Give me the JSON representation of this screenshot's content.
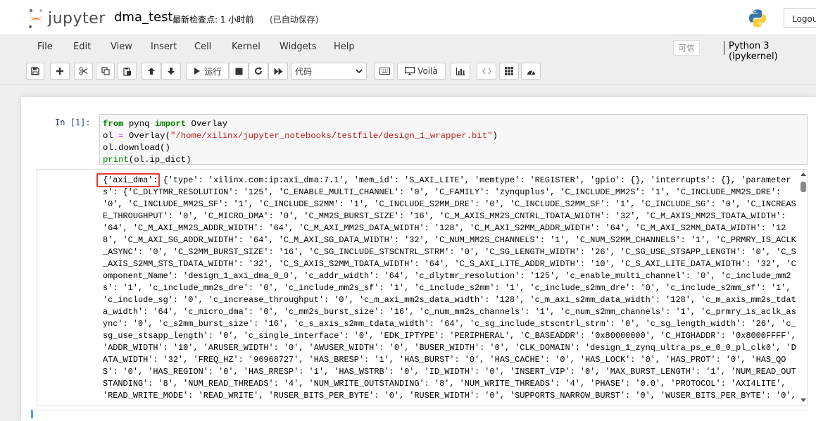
{
  "header": {
    "logo_text": "jupyter",
    "notebook_name": "dma_test",
    "checkpoint": "最新检查点: 1 小时前",
    "autosave": "(已自动保存)",
    "logout_label": "Logout"
  },
  "menubar": {
    "items": [
      "File",
      "Edit",
      "View",
      "Insert",
      "Cell",
      "Kernel",
      "Widgets",
      "Help"
    ],
    "trusted_label": "可信",
    "kernel_name": "Python 3 (ipykernel)"
  },
  "toolbar": {
    "save_icon": "save-icon",
    "add_icon": "plus-icon",
    "cut_icon": "scissors-icon",
    "copy_icon": "copy-icon",
    "paste_icon": "paste-icon",
    "move_up_icon": "arrow-up-icon",
    "move_down_icon": "arrow-down-icon",
    "run_label": "运行",
    "cell_type_selected": "代码",
    "voila_label": "Voilà"
  },
  "cell": {
    "prompt": "In  [1]:",
    "code": {
      "line1_kw1": "from",
      "line1_mod": " pynq ",
      "line1_kw2": "import",
      "line1_name": " Overlay",
      "line2_var": "ol ",
      "line2_eq": "=",
      "line2_call": " Overlay(",
      "line2_str": "\"/home/xilinx/jupyter_notebooks/testfile/design_1_wrapper.bit\"",
      "line2_close": ")",
      "line3": "ol.download()",
      "line4_fn": "print",
      "line4_rest": "(ol.ip_dict)"
    },
    "output_lines": [
      "{'axi_dma': {'type': 'xilinx.com:ip:axi_dma:7.1', 'mem_id': 'S_AXI_LITE', 'memtype': 'REGISTER', 'gpio': {}, 'interrupts': {}, 'parameter",
      "s': {'C_DLYTMR_RESOLUTION': '125', 'C_ENABLE_MULTI_CHANNEL': '0', 'C_FAMILY': 'zynquplus', 'C_INCLUDE_MM2S': '1', 'C_INCLUDE_MM2S_DRE':",
      "'0', 'C_INCLUDE_MM2S_SF': '1', 'C_INCLUDE_S2MM': '1', 'C_INCLUDE_S2MM_DRE': '0', 'C_INCLUDE_S2MM_SF': '1', 'C_INCLUDE_SG': '0', 'C_INCREAS",
      "E_THROUGHPUT': '0', 'C_MICRO_DMA': '0', 'C_MM2S_BURST_SIZE': '16', 'C_M_AXIS_MM2S_CNTRL_TDATA_WIDTH': '32', 'C_M_AXIS_MM2S_TDATA_WIDTH':",
      "'64', 'C_M_AXI_MM2S_ADDR_WIDTH': '64', 'C_M_AXI_MM2S_DATA_WIDTH': '128', 'C_M_AXI_S2MM_ADDR_WIDTH': '64', 'C_M_AXI_S2MM_DATA_WIDTH': '12",
      "8', 'C_M_AXI_SG_ADDR_WIDTH': '64', 'C_M_AXI_SG_DATA_WIDTH': '32', 'C_NUM_MM2S_CHANNELS': '1', 'C_NUM_S2MM_CHANNELS': '1', 'C_PRMRY_IS_ACLK",
      "_ASYNC': '0', 'C_S2MM_BURST_SIZE': '16', 'C_SG_INCLUDE_STSCNTRL_STRM': '0', 'C_SG_LENGTH_WIDTH': '26', 'C_SG_USE_STSAPP_LENGTH': '0', 'C_S",
      "_AXIS_S2MM_STS_TDATA_WIDTH': '32', 'C_S_AXIS_S2MM_TDATA_WIDTH': '64', 'C_S_AXI_LITE_ADDR_WIDTH': '10', 'C_S_AXI_LITE_DATA_WIDTH': '32', 'C",
      "omponent_Name': 'design_1_axi_dma_0_0', 'c_addr_width': '64', 'c_dlytmr_resolution': '125', 'c_enable_multi_channel': '0', 'c_include_mm2",
      "s': '1', 'c_include_mm2s_dre': '0', 'c_include_mm2s_sf': '1', 'c_include_s2mm': '1', 'c_include_s2mm_dre': '0', 'c_include_s2mm_sf': '1',",
      "'c_include_sg': '0', 'c_increase_throughput': '0', 'c_m_axi_mm2s_data_width': '128', 'c_m_axi_s2mm_data_width': '128', 'c_m_axis_mm2s_tdat",
      "a_width': '64', 'c_micro_dma': '0', 'c_mm2s_burst_size': '16', 'c_num_mm2s_channels': '1', 'c_num_s2mm_channels': '1', 'c_prmry_is_aclk_as",
      "ync': '0', 'c_s2mm_burst_size': '16', 'c_s_axis_s2mm_tdata_width': '64', 'c_sg_include_stscntrl_strm': '0', 'c_sg_length_width': '26', 'c_",
      "sg_use_stsapp_length': '0', 'c_single_interface': '0', 'EDK_IPTYPE': 'PERIPHERAL', 'C_BASEADDR': '0x80000000', 'C_HIGHADDR': '0x8000FFFF',",
      "'ADDR_WIDTH': '10', 'ARUSER_WIDTH': '0', 'AWUSER_WIDTH': '0', 'BUSER_WIDTH': '0', 'CLK_DOMAIN': 'design_1_zynq_ultra_ps_e_0_0_pl_clk0', 'D",
      "ATA_WIDTH': '32', 'FREQ_HZ': '96968727', 'HAS_BRESP': '1', 'HAS_BURST': '0', 'HAS_CACHE': '0', 'HAS_LOCK': '0', 'HAS_PROT': '0', 'HAS_QO",
      "S': '0', 'HAS_REGION': '0', 'HAS_RRESP': '1', 'HAS_WSTRB': '0', 'ID_WIDTH': '0', 'INSERT_VIP': '0', 'MAX_BURST_LENGTH': '1', 'NUM_READ_OUT",
      "STANDING': '8', 'NUM_READ_THREADS': '4', 'NUM_WRITE_OUTSTANDING': '8', 'NUM_WRITE_THREADS': '4', 'PHASE': '0.0', 'PROTOCOL': 'AXI4LITE',",
      "'READ_WRITE_MODE': 'READ_WRITE', 'RUSER_BITS_PER_BYTE': '0', 'RUSER_WIDTH': '0', 'SUPPORTS_NARROW_BURST': '0', 'WUSER_BITS_PER_BYTE': '0',"
    ]
  },
  "colors": {
    "prompt_in": "#303f9f",
    "keyword": "#008000",
    "string": "#ba2121",
    "highlight_box": "#e53935",
    "active_cell_border": "#42a5f5"
  }
}
